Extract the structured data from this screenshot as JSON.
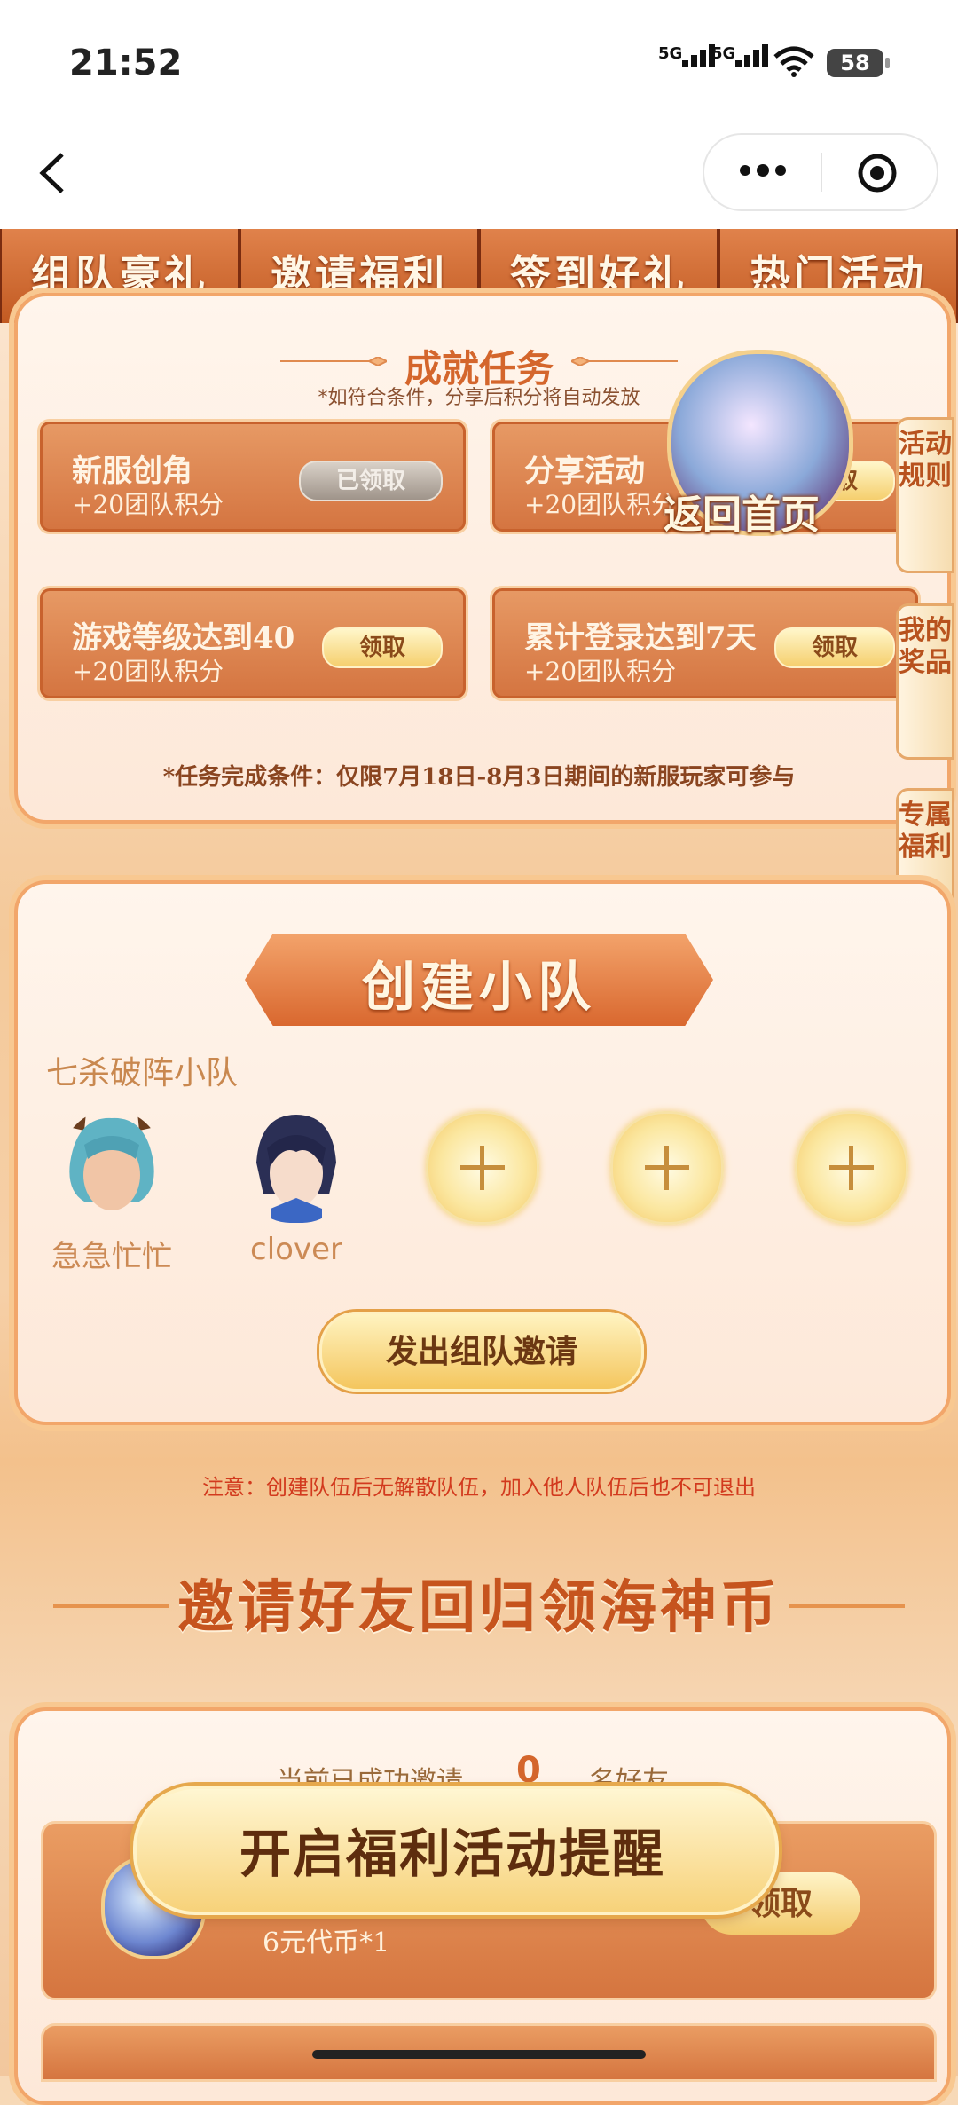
{
  "status_bar": {
    "time": "21:52",
    "signal1": "5G",
    "signal2": "5G",
    "battery": "58"
  },
  "tabs": [
    "组队豪礼",
    "邀请福利",
    "签到好礼",
    "热门活动"
  ],
  "achievement": {
    "title": "成就任务",
    "subtitle": "*如符合条件，分享后积分将自动发放",
    "tasks": [
      {
        "name": "新服创角",
        "reward": "+20团队积分",
        "button": "已领取",
        "claimed": true
      },
      {
        "name": "分享活动",
        "reward": "+20团队积分",
        "button": "领取",
        "claimed": false
      },
      {
        "name": "游戏等级达到40",
        "reward": "+20团队积分",
        "button": "领取",
        "claimed": false
      },
      {
        "name": "累计登录达到7天",
        "reward": "+20团队积分",
        "button": "领取",
        "claimed": false
      }
    ],
    "note": "*任务完成条件：仅限7月18日-8月3日期间的新服玩家可参与"
  },
  "return_home": "返回首页",
  "side_tabs": [
    "活动规则",
    "我的奖品",
    "专属福利"
  ],
  "team": {
    "banner": "创建小队",
    "name": "七杀破阵小队",
    "members": [
      {
        "name": "急急忙忙",
        "avatar_color": "#5fb3c4"
      },
      {
        "name": "clover",
        "avatar_color": "#2b2f55"
      }
    ],
    "empty_slots": 3,
    "invite_button": "发出组队邀请",
    "warning": "注意：创建队伍后无解散队伍，加入他人队伍后也不可退出"
  },
  "invite": {
    "heading": "邀请好友回归领海神币",
    "count_prefix": "当前已成功邀请",
    "count": "0",
    "count_suffix": "名好友",
    "reward": "6元代币*1",
    "claim_button": "领取"
  },
  "reminder_banner": "开启福利活动提醒",
  "colors": {
    "accent": "#d4662c",
    "tab": "#d06a33",
    "warning": "#d23a1e"
  }
}
